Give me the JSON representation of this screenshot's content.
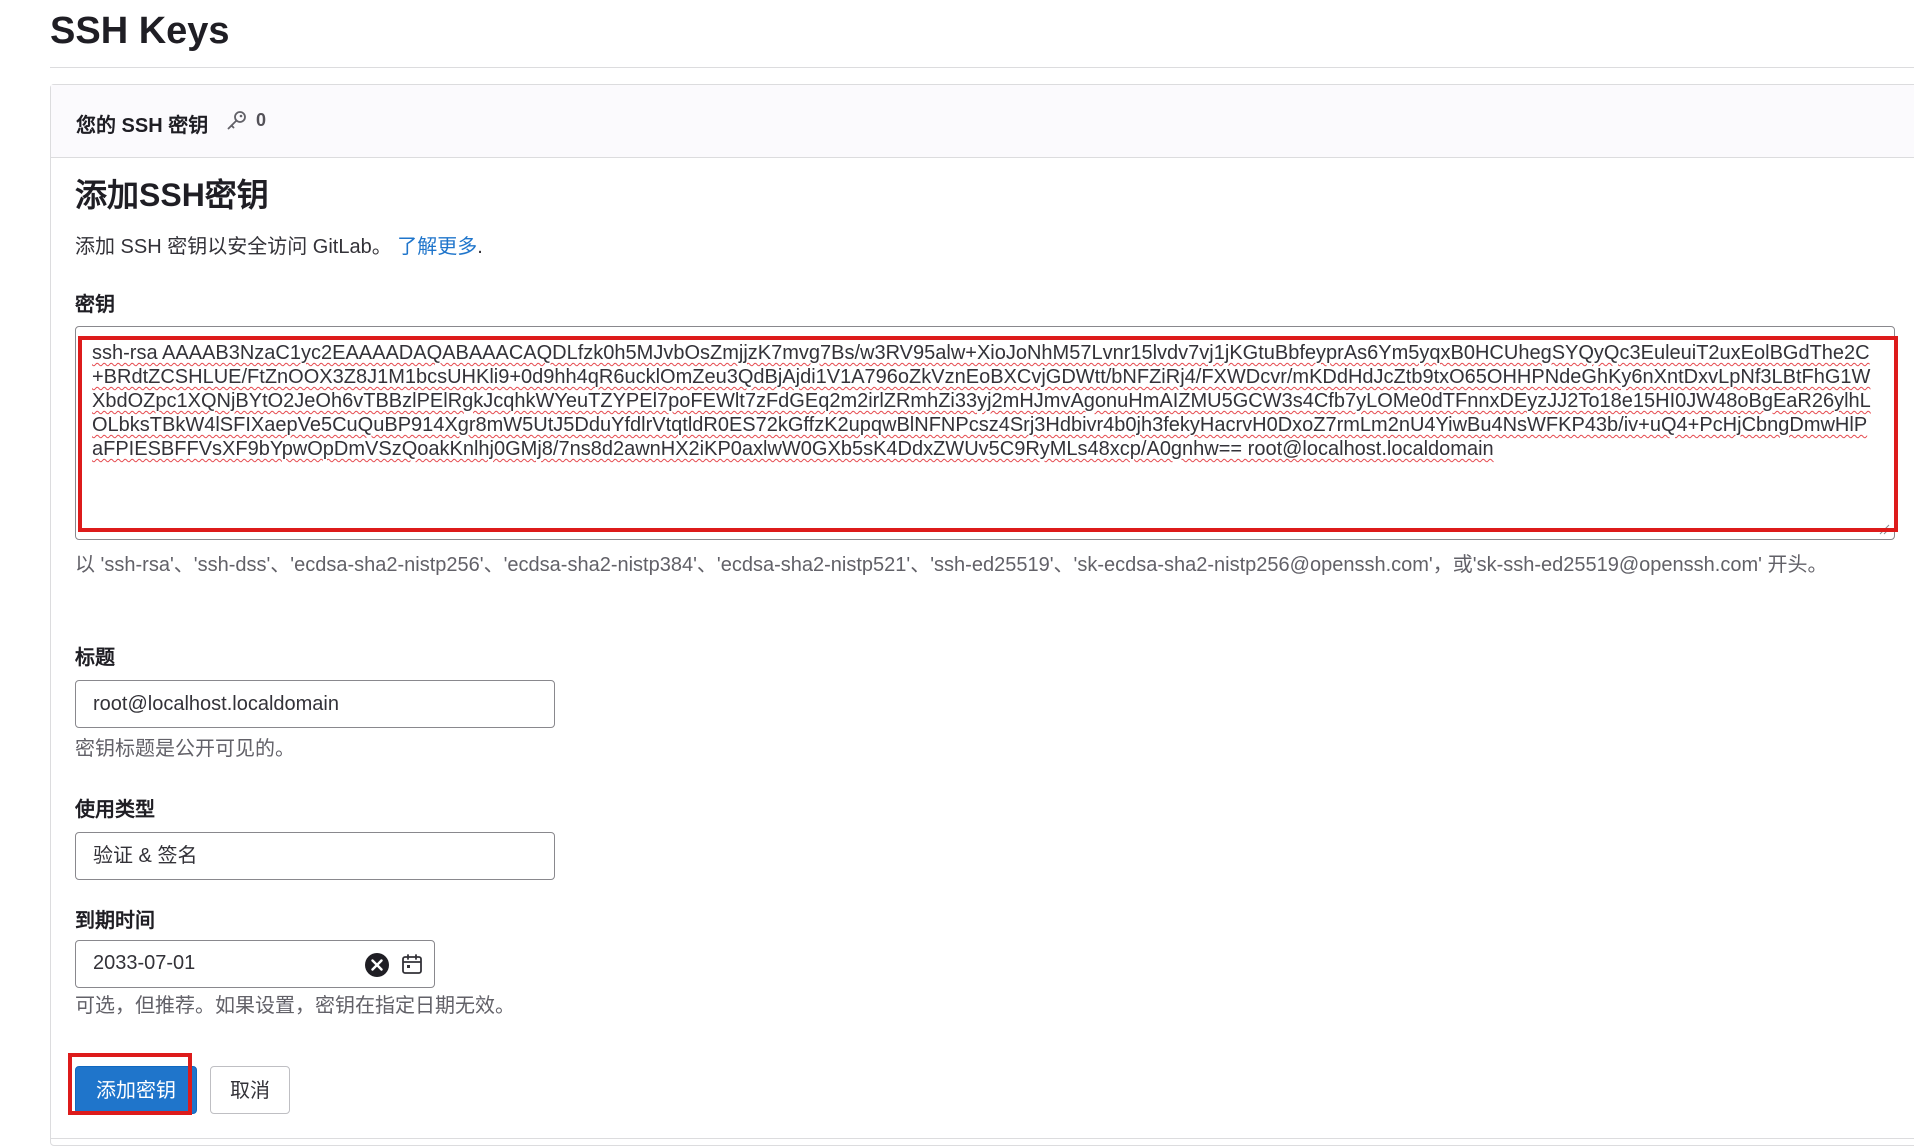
{
  "page": {
    "title": "SSH Keys"
  },
  "card_header": {
    "title": "您的 SSH 密钥",
    "icon": "key-icon",
    "count": "0"
  },
  "form": {
    "heading": "添加SSH密钥",
    "intro_text": "添加 SSH 密钥以安全访问 GitLab。",
    "learn_more": "了解更多",
    "intro_suffix": ".",
    "key": {
      "label": "密钥",
      "value": "ssh-rsa AAAAB3NzaC1yc2EAAAADAQABAAACAQDLfzk0h5MJvbOsZmjjzK7mvg7Bs/w3RV95alw+XioJoNhM57Lvnr15lvdv7vj1jKGtuBbfeyprAs6Ym5yqxB0HCUhegSYQyQc3EuleuiT2uxEolBGdThe2C+BRdtZCSHLUE/FtZnOOX3Z8J1M1bcsUHKli9+0d9hh4qR6ucklOmZeu3QdBjAjdi1V1A796oZkVznEoBXCvjGDWtt/bNFZiRj4/FXWDcvr/mKDdHdJcZtb9txO65OHHPNdeGhKy6nXntDxvLpNf3LBtFhG1WXbdOZpc1XQNjBYtO2JeOh6vTBBzlPElRgkJcqhkWYeuTZYPEl7poFEWlt7zFdGEq2m2irlZRmhZi33yj2mHJmvAgonuHmAIZMU5GCW3s4Cfb7yLOMe0dTFnnxDEyzJJ2To18e15HI0JW48oBgEaR26ylhLOLbksTBkW4lSFIXaepVe5CuQuBP914Xgr8mW5UtJ5DduYfdlrVtqtldR0ES72kGffzK2upqwBlNFNPcsz4Srj3Hdbivr4b0jh3fekyHacrvH0DxoZ7rmLm2nU4YiwBu4NsWFKP43b/iv+uQ4+PcHjCbngDmwHlPaFPIESBFFVsXF9bYpwOpDmVSzQoakKnlhj0GMj8/7ns8d2awnHX2iKP0axlwW0GXb5sK4DdxZWUv5C9RyMLs48xcp/A0gnhw== root@localhost.localdomain",
      "help": "以 'ssh-rsa'、'ssh-dss'、'ecdsa-sha2-nistp256'、'ecdsa-sha2-nistp384'、'ecdsa-sha2-nistp521'、'ssh-ed25519'、'sk-ecdsa-sha2-nistp256@openssh.com'，或'sk-ssh-ed25519@openssh.com' 开头。"
    },
    "title": {
      "label": "标题",
      "value": "root@localhost.localdomain",
      "help": "密钥标题是公开可见的。"
    },
    "usage_type": {
      "label": "使用类型",
      "value": "验证 & 签名"
    },
    "expiration": {
      "label": "到期时间",
      "value": "2033-07-01",
      "help": "可选，但推荐。如果设置，密钥在指定日期无效。"
    },
    "buttons": {
      "add": "添加密钥",
      "cancel": "取消"
    }
  },
  "annotation_color": "#dd1b1b",
  "accent_color": "#1f75cb"
}
